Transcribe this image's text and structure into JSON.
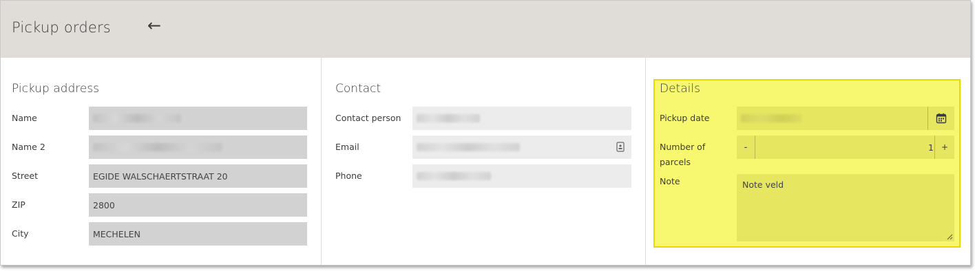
{
  "header": {
    "title": "Pickup orders",
    "back_icon": "arrow-left-icon"
  },
  "pickup_address": {
    "title": "Pickup address",
    "fields": [
      {
        "label": "Name",
        "value": ""
      },
      {
        "label": "Name 2",
        "value": ""
      },
      {
        "label": "Street",
        "value": "EGIDE WALSCHAERTSTRAAT 20"
      },
      {
        "label": "ZIP",
        "value": "2800"
      },
      {
        "label": "City",
        "value": "MECHELEN"
      }
    ]
  },
  "contact": {
    "title": "Contact",
    "fields": [
      {
        "label": "Contact person",
        "value": ""
      },
      {
        "label": "Email",
        "value": "",
        "icon": "contact-card-icon"
      },
      {
        "label": "Phone",
        "value": ""
      }
    ]
  },
  "details": {
    "title": "Details",
    "pickup_date": {
      "label": "Pickup date",
      "value": "",
      "icon": "calendar-icon"
    },
    "parcels": {
      "label_line1": "Number of",
      "label_line2": "parcels",
      "minus": "-",
      "value": "1",
      "plus": "+"
    },
    "note": {
      "label": "Note",
      "value": "Note veld"
    },
    "highlight_color": "#f8f870"
  }
}
